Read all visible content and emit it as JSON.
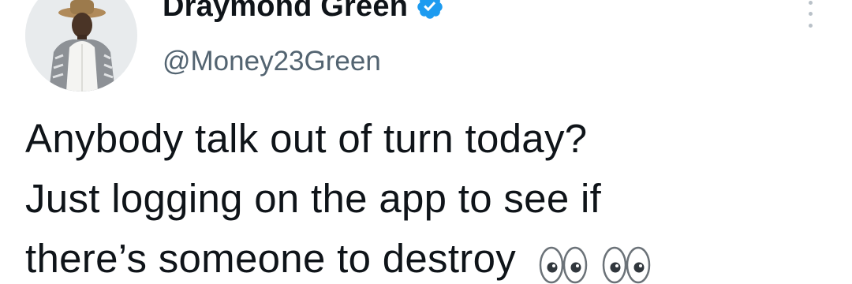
{
  "author": {
    "display_name": "Draymond Green",
    "handle": "@Money23Green",
    "verified": true,
    "avatar_icon": "profile-photo"
  },
  "tweet": {
    "lines": [
      "Anybody talk out of turn today?",
      "Just logging on the app to see if",
      "there’s someone to destroy"
    ],
    "emojis": [
      "eyes-emoji",
      "eyes-emoji"
    ]
  },
  "menu": {
    "icon": "more-vertical-icon"
  },
  "colors": {
    "text": "#0f1419",
    "secondary_text": "#536471",
    "verified_badge": "#1d9bf0",
    "menu_dots": "#b9c1c8",
    "background": "#ffffff"
  }
}
